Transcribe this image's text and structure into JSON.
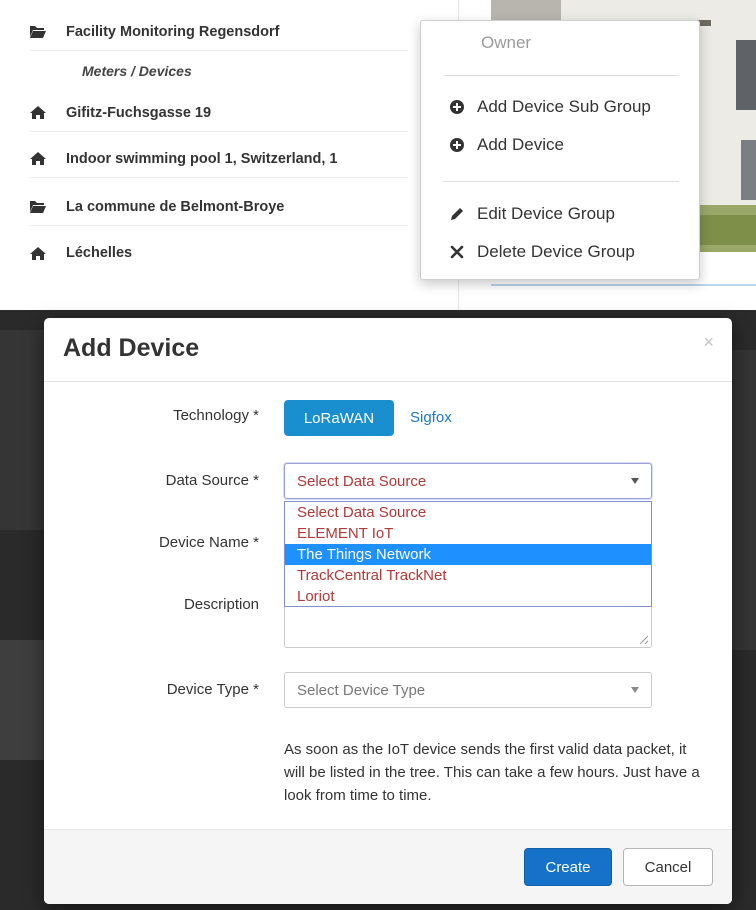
{
  "tree": {
    "items": [
      {
        "label": "Facility Monitoring Regensdorf",
        "icon": "folder-open-icon"
      },
      {
        "label": "Meters / Devices",
        "icon": ""
      },
      {
        "label": "Gifitz-Fuchsgasse 19",
        "icon": "home-icon"
      },
      {
        "label": "Indoor swimming pool 1, Switzerland, 1",
        "icon": "home-icon"
      },
      {
        "label": "La commune de Belmont-Broye",
        "icon": "folder-open-icon"
      },
      {
        "label": "Léchelles",
        "icon": "home-icon"
      }
    ]
  },
  "context_menu": {
    "owner": "Owner",
    "add_sub_group": "Add Device Sub Group",
    "add_device": "Add Device",
    "edit_group": "Edit Device Group",
    "delete_group": "Delete Device Group"
  },
  "modal": {
    "title": "Add Device",
    "close": "×",
    "technology_label": "Technology *",
    "technology_options": [
      "LoRaWAN",
      "Sigfox"
    ],
    "data_source_label": "Data Source *",
    "data_source_value": "Select Data Source",
    "data_source_options": [
      "Select Data Source",
      "ELEMENT IoT",
      "The Things Network",
      "TrackCentral TrackNet",
      "Loriot"
    ],
    "data_source_highlighted": "The Things Network",
    "device_name_label": "Device Name *",
    "description_label": "Description",
    "device_type_label": "Device Type *",
    "device_type_placeholder": "Select Device Type",
    "help_text": "As soon as the IoT device sends the first valid data packet, it will be listed in the tree. This can take a few hours. Just have a look from time to time.",
    "create_label": "Create",
    "cancel_label": "Cancel"
  },
  "colors": {
    "primary": "#1672c8",
    "lorawan": "#1a8fcf",
    "link": "#1a7bbd",
    "highlight": "#1e90ff",
    "option_text": "#b03a3a"
  }
}
